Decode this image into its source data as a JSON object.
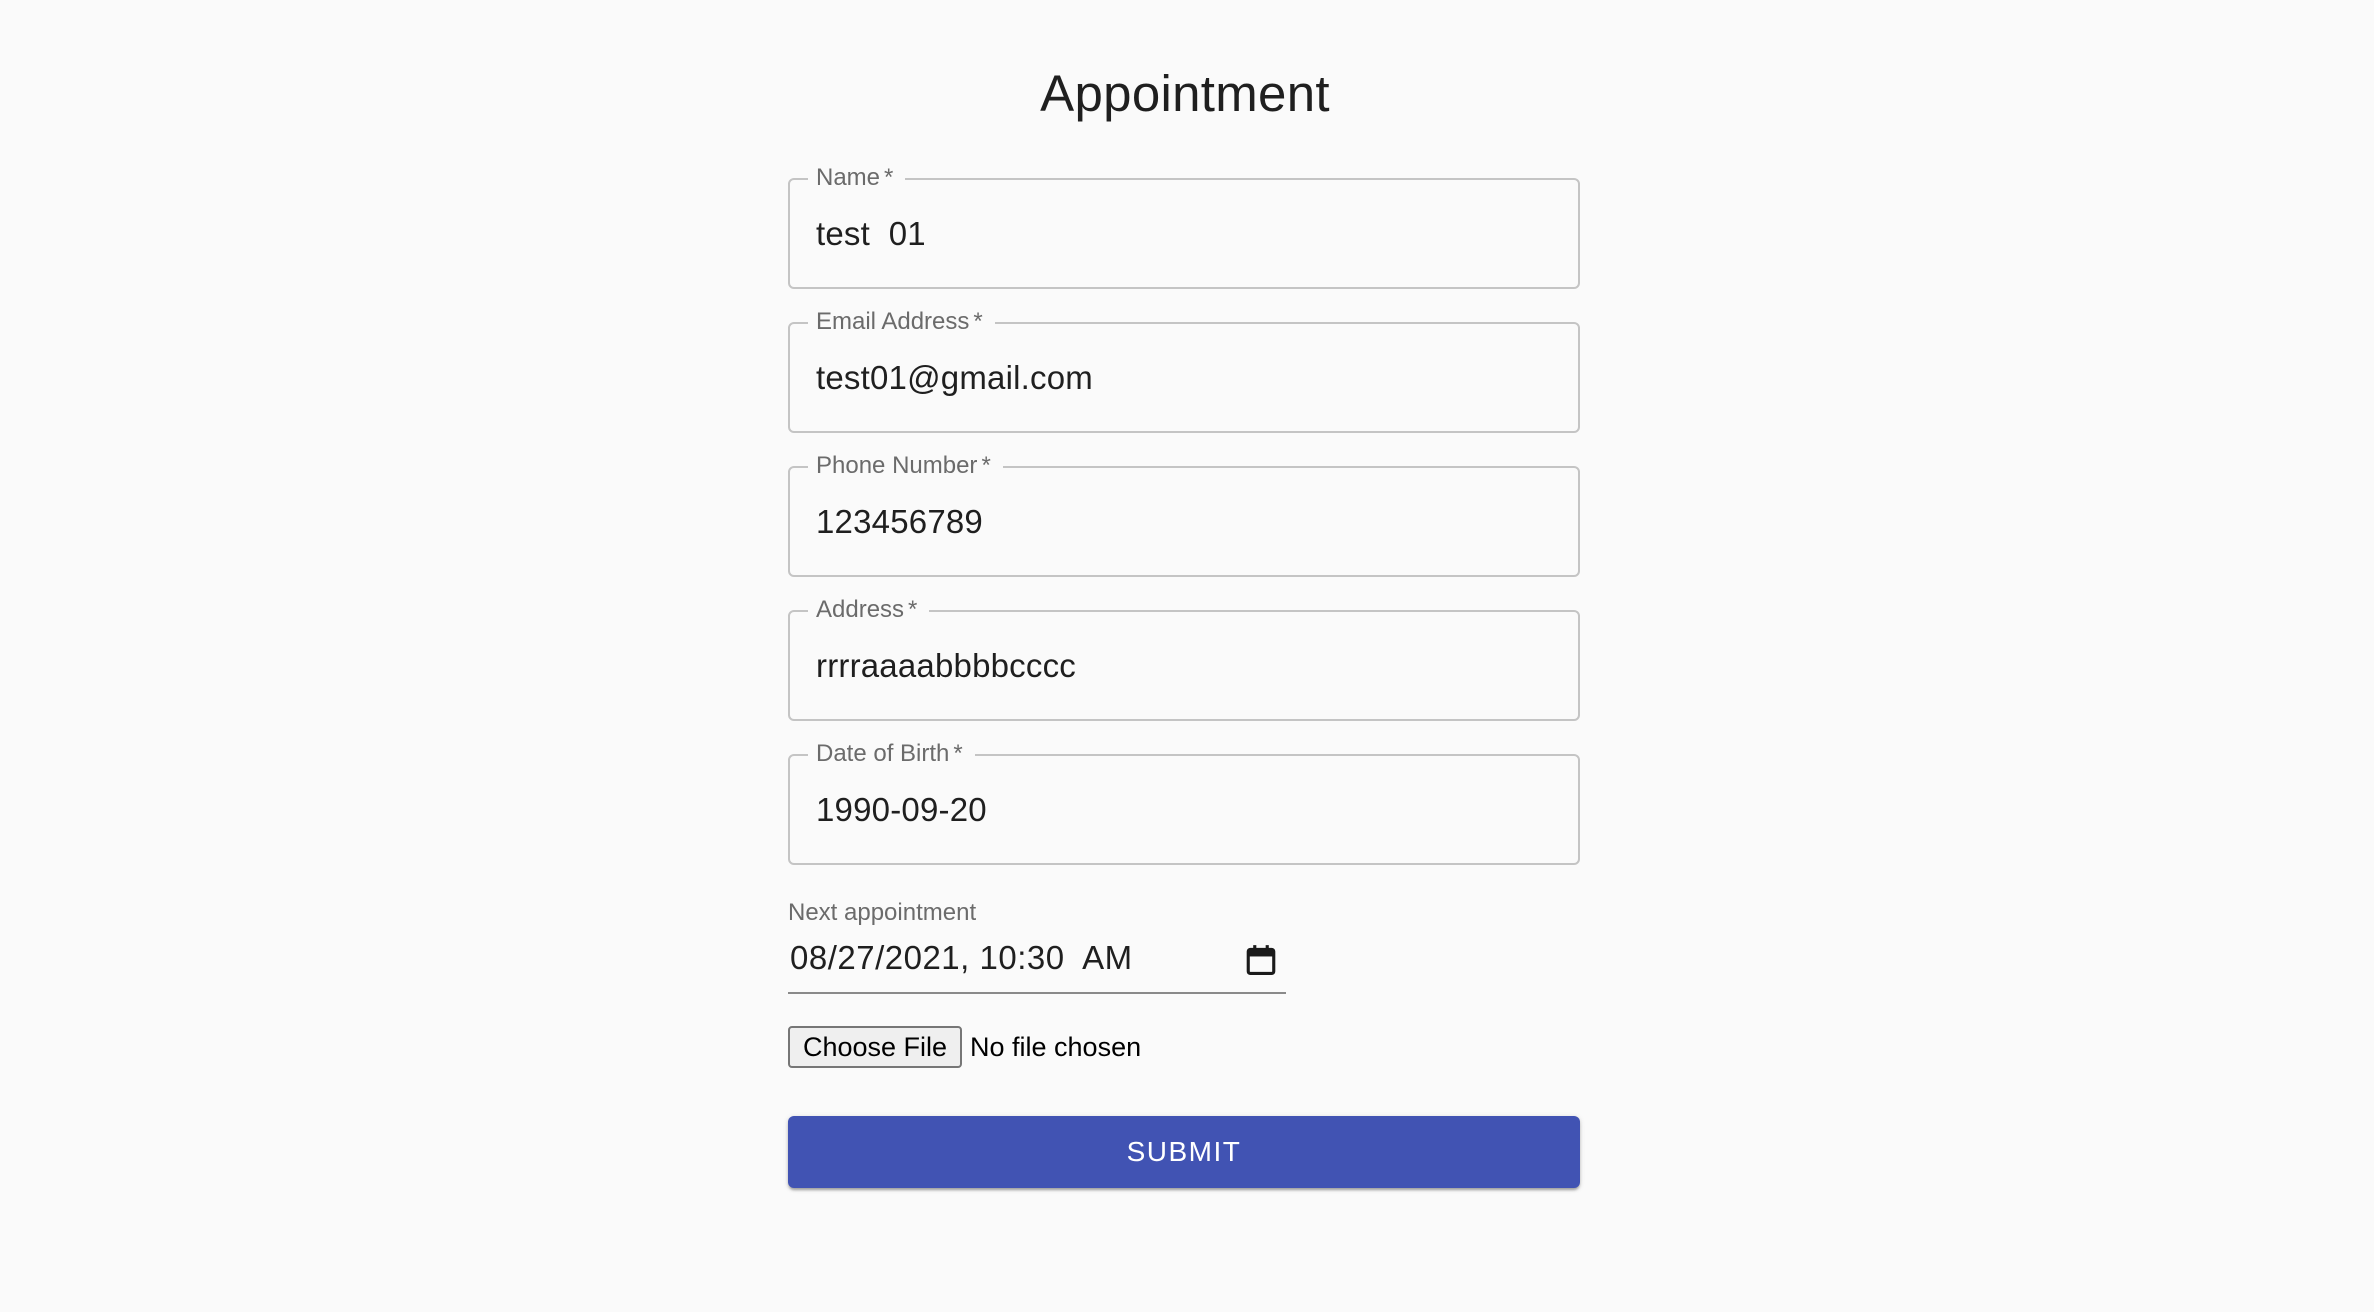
{
  "page": {
    "title": "Appointment"
  },
  "form": {
    "fields": [
      {
        "label": "Name",
        "required_mark": "*",
        "value": "test  01"
      },
      {
        "label": "Email Address",
        "required_mark": "*",
        "value": "test01@gmail.com"
      },
      {
        "label": "Phone Number",
        "required_mark": "*",
        "value": "123456789"
      },
      {
        "label": "Address",
        "required_mark": "*",
        "value": "rrrraaaabbbbcccc"
      },
      {
        "label": "Date of Birth",
        "required_mark": "*",
        "value": "1990-09-20"
      }
    ],
    "next_appointment": {
      "label": "Next appointment",
      "value": "08/27/2021, 10:30  AM",
      "icon": "calendar-icon"
    },
    "file_input": {
      "button_label": "Choose File",
      "status": "No file chosen"
    },
    "submit_label": "SUBMIT"
  },
  "colors": {
    "background": "#fafafa",
    "primary": "#4153b3",
    "border": "#c4c4c4",
    "label": "#6b6b6b"
  }
}
